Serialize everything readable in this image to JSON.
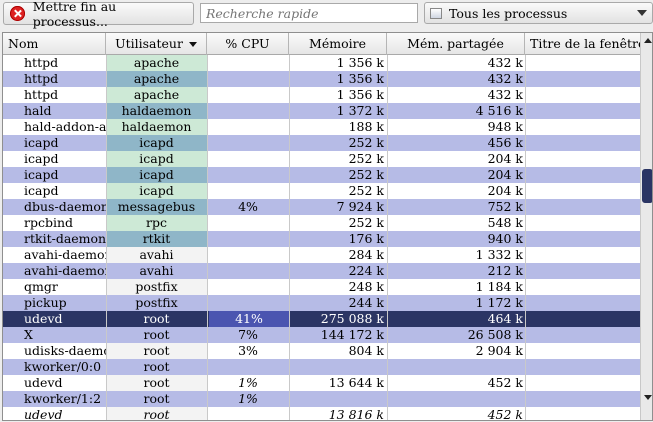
{
  "toolbar": {
    "kill_label": "Mettre fin au processus...",
    "search_placeholder": "Recherche rapide",
    "filter_label": "Tous les processus"
  },
  "columns": [
    "Nom",
    "Utilisateur",
    "% CPU",
    "Mémoire",
    "Mém. partagée",
    "Titre de la fenêtre"
  ],
  "rows": [
    {
      "name": "httpd",
      "user": "apache",
      "cpu": "",
      "mem": "1 356 k",
      "shr": "432 k",
      "title": "",
      "uc": "light"
    },
    {
      "name": "httpd",
      "user": "apache",
      "cpu": "",
      "mem": "1 356 k",
      "shr": "432 k",
      "title": "",
      "uc": "dark"
    },
    {
      "name": "httpd",
      "user": "apache",
      "cpu": "",
      "mem": "1 356 k",
      "shr": "432 k",
      "title": "",
      "uc": "light"
    },
    {
      "name": "hald",
      "user": "haldaemon",
      "cpu": "",
      "mem": "1 372 k",
      "shr": "4 516 k",
      "title": "",
      "uc": "dark"
    },
    {
      "name": "hald-addon-a",
      "user": "haldaemon",
      "cpu": "",
      "mem": "188 k",
      "shr": "948 k",
      "title": "",
      "uc": "light"
    },
    {
      "name": "icapd",
      "user": "icapd",
      "cpu": "",
      "mem": "252 k",
      "shr": "456 k",
      "title": "",
      "uc": "dark"
    },
    {
      "name": "icapd",
      "user": "icapd",
      "cpu": "",
      "mem": "252 k",
      "shr": "204 k",
      "title": "",
      "uc": "light"
    },
    {
      "name": "icapd",
      "user": "icapd",
      "cpu": "",
      "mem": "252 k",
      "shr": "204 k",
      "title": "",
      "uc": "dark"
    },
    {
      "name": "icapd",
      "user": "icapd",
      "cpu": "",
      "mem": "252 k",
      "shr": "204 k",
      "title": "",
      "uc": "light"
    },
    {
      "name": "dbus-daemon",
      "user": "messagebus",
      "cpu": "4%",
      "mem": "7 924 k",
      "shr": "752 k",
      "title": "",
      "uc": "dark"
    },
    {
      "name": "rpcbind",
      "user": "rpc",
      "cpu": "",
      "mem": "252 k",
      "shr": "548 k",
      "title": "",
      "uc": "light"
    },
    {
      "name": "rtkit-daemon",
      "user": "rtkit",
      "cpu": "",
      "mem": "176 k",
      "shr": "940 k",
      "title": "",
      "uc": "dark"
    },
    {
      "name": "avahi-daemon",
      "user": "avahi",
      "cpu": "",
      "mem": "284 k",
      "shr": "1 332 k",
      "title": "",
      "uc": "plain"
    },
    {
      "name": "avahi-daemon",
      "user": "avahi",
      "cpu": "",
      "mem": "224 k",
      "shr": "212 k",
      "title": "",
      "uc": "plain"
    },
    {
      "name": "qmgr",
      "user": "postfix",
      "cpu": "",
      "mem": "248 k",
      "shr": "1 184 k",
      "title": "",
      "uc": "plain"
    },
    {
      "name": "pickup",
      "user": "postfix",
      "cpu": "",
      "mem": "244 k",
      "shr": "1 172 k",
      "title": "",
      "uc": "plain"
    },
    {
      "name": "udevd",
      "user": "root",
      "cpu": "41%",
      "mem": "275 088 k",
      "shr": "464 k",
      "title": "",
      "uc": "plain",
      "selected": true
    },
    {
      "name": "X",
      "user": "root",
      "cpu": "7%",
      "mem": "144 172 k",
      "shr": "26 508 k",
      "title": "",
      "uc": "plain"
    },
    {
      "name": "udisks-daemon",
      "user": "root",
      "cpu": "3%",
      "mem": "804 k",
      "shr": "2 904 k",
      "title": "",
      "uc": "plain"
    },
    {
      "name": "kworker/0:0",
      "user": "root",
      "cpu": "",
      "mem": "",
      "shr": "",
      "title": "",
      "uc": "plain"
    },
    {
      "name": "udevd",
      "user": "root",
      "cpu": "1%",
      "mem": "13 644 k",
      "shr": "452 k",
      "title": "",
      "uc": "plain",
      "cpu_italic": true
    },
    {
      "name": "kworker/1:2",
      "user": "root",
      "cpu": "1%",
      "mem": "",
      "shr": "",
      "title": "",
      "uc": "plain",
      "cpu_italic": true
    },
    {
      "name": "udevd",
      "user": "root",
      "cpu": "",
      "mem": "13 816 k",
      "shr": "452 k",
      "title": "",
      "uc": "plain",
      "italic": true
    }
  ],
  "icons": {
    "kill": "stop-icon",
    "filter": "window-icon",
    "sort": "sort-desc-icon"
  }
}
